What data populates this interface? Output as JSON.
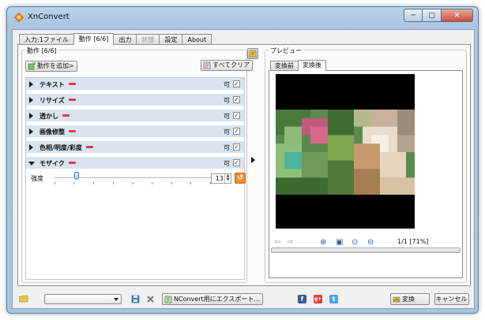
{
  "window": {
    "title": "XnConvert",
    "controls": [
      "─",
      "□",
      "✕"
    ]
  },
  "tabs": [
    {
      "label": "入力:1ファイル",
      "state": "normal"
    },
    {
      "label": "動作 [6/6]",
      "state": "active"
    },
    {
      "label": "出力",
      "state": "normal"
    },
    {
      "label": "状態",
      "state": "disabled"
    },
    {
      "label": "設定",
      "state": "normal"
    },
    {
      "label": "About",
      "state": "normal"
    }
  ],
  "actions": {
    "group_title": "動作 [6/6]",
    "add_label": "動作を追加>",
    "clear_label": "すべてクリア",
    "items": [
      {
        "label": "テキスト",
        "enabled_label": "可",
        "checked": true,
        "expanded": false
      },
      {
        "label": "リサイズ",
        "enabled_label": "可",
        "checked": true,
        "expanded": false
      },
      {
        "label": "透かし",
        "enabled_label": "可",
        "checked": true,
        "expanded": false
      },
      {
        "label": "画像修整",
        "enabled_label": "可",
        "checked": true,
        "expanded": false
      },
      {
        "label": "色相/明度/彩度",
        "enabled_label": "可",
        "checked": true,
        "expanded": false
      },
      {
        "label": "モザイク",
        "enabled_label": "可",
        "checked": true,
        "expanded": true
      }
    ],
    "mosaic": {
      "strength_label": "強度",
      "strength_value": "13",
      "slider_fraction": 0.14
    }
  },
  "preview": {
    "group_title": "プレビュー",
    "tabs": [
      {
        "label": "変換前",
        "active": false
      },
      {
        "label": "変換後",
        "active": true
      }
    ],
    "page_info": "1/1 [71%]"
  },
  "bottom": {
    "export_label": "NConvert用にエクスポート...",
    "convert_label": "変換",
    "cancel_label": "キャンセル",
    "social": [
      "f",
      "g+",
      "t"
    ]
  },
  "colors": {
    "accent_row": "#d9e4ef",
    "minus": "#e13a55",
    "reset": "#f08c2a"
  }
}
